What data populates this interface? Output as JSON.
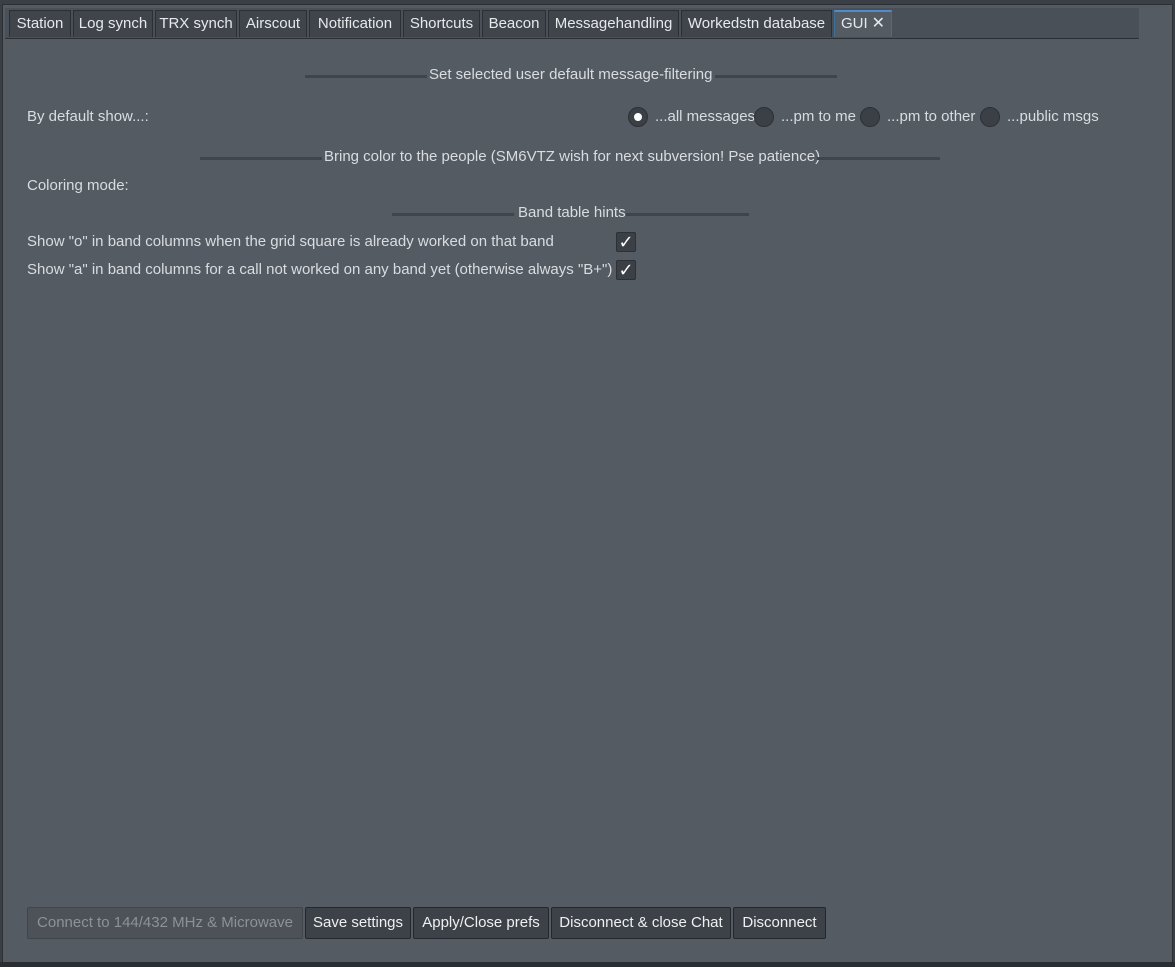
{
  "tabs": [
    {
      "label": "Station"
    },
    {
      "label": "Log synch"
    },
    {
      "label": "TRX synch"
    },
    {
      "label": "Airscout"
    },
    {
      "label": "Notification"
    },
    {
      "label": "Shortcuts"
    },
    {
      "label": "Beacon"
    },
    {
      "label": "Messagehandling"
    },
    {
      "label": "Workedstn database"
    },
    {
      "label": "GUI",
      "active": true,
      "close_icon": "close-icon"
    }
  ],
  "filtering": {
    "section_title": "Set selected user default message-filtering",
    "label": "By default show...:",
    "options": [
      {
        "label": "...all messages",
        "checked": true
      },
      {
        "label": "...pm to me",
        "checked": false
      },
      {
        "label": "...pm to other",
        "checked": false
      },
      {
        "label": "...public msgs",
        "checked": false
      }
    ]
  },
  "coloring": {
    "section_title": "Bring color to the people (SM6VTZ wish for next subversion! Pse patience)",
    "label": "Coloring mode:"
  },
  "hints": {
    "section_title": "Band table hints",
    "items": [
      {
        "label": "Show \"o\" in band columns when the grid square is already worked on that band",
        "checked": true
      },
      {
        "label": "Show \"a\" in band columns for a call not worked on any band yet (otherwise always \"B+\")",
        "checked": true
      }
    ],
    "check_glyph": "✓"
  },
  "buttons": {
    "connect": "Connect to 144/432 MHz & Microwave",
    "save": "Save settings",
    "apply": "Apply/Close prefs",
    "disconnect_close": "Disconnect & close Chat",
    "disconnect": "Disconnect"
  },
  "colors": {
    "background": "#545b62",
    "accent": "#4f8cc9"
  }
}
